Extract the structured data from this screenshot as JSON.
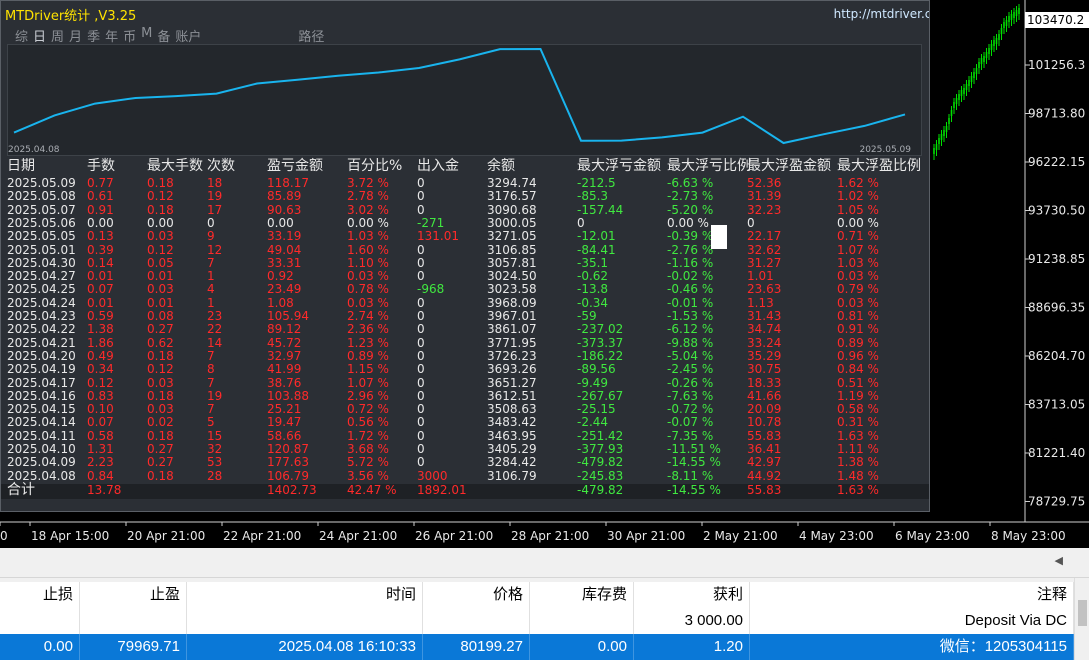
{
  "panel": {
    "title": "MTDriver统计 ,V3.25",
    "url": "http://mtdriver.cn",
    "tabs": [
      "综",
      "日",
      "周",
      "月",
      "季",
      "年",
      "币",
      "M",
      "备",
      "账户",
      "路径"
    ],
    "active_tab": 1,
    "equity": {
      "start_date": "2025.04.08",
      "end_date": "2025.05.09"
    }
  },
  "stats": {
    "headers": [
      "日期",
      "手数",
      "最大手数",
      "次数",
      "盈亏金额",
      "百分比%",
      "出入金",
      "余额",
      "最大浮亏金额",
      "最大浮亏比例",
      "最大浮盈金额",
      "最大浮盈比例"
    ],
    "rows": [
      [
        "2025.05.09",
        "0.77",
        "0.18",
        "18",
        "118.17",
        "3.72 %",
        "0",
        "3294.74",
        "-212.5",
        "-6.63 %",
        "52.36",
        "1.62 %"
      ],
      [
        "2025.05.08",
        "0.61",
        "0.12",
        "19",
        "85.89",
        "2.78 %",
        "0",
        "3176.57",
        "-85.3",
        "-2.73 %",
        "31.39",
        "1.02 %"
      ],
      [
        "2025.05.07",
        "0.91",
        "0.18",
        "17",
        "90.63",
        "3.02 %",
        "0",
        "3090.68",
        "-157.44",
        "-5.20 %",
        "32.23",
        "1.05 %"
      ],
      [
        "2025.05.06",
        "0.00",
        "0.00",
        "0",
        "0.00",
        "0.00 %",
        "-271",
        "3000.05",
        "0",
        "0.00 %",
        "0",
        "0.00 %"
      ],
      [
        "2025.05.05",
        "0.13",
        "0.03",
        "9",
        "33.19",
        "1.03 %",
        "131.01",
        "3271.05",
        "-12.01",
        "-0.39 %",
        "22.17",
        "0.71 %"
      ],
      [
        "2025.05.01",
        "0.39",
        "0.12",
        "12",
        "49.04",
        "1.60 %",
        "0",
        "3106.85",
        "-84.41",
        "-2.76 %",
        "32.62",
        "1.07 %"
      ],
      [
        "2025.04.30",
        "0.14",
        "0.05",
        "7",
        "33.31",
        "1.10 %",
        "0",
        "3057.81",
        "-35.1",
        "-1.16 %",
        "31.27",
        "1.03 %"
      ],
      [
        "2025.04.27",
        "0.01",
        "0.01",
        "1",
        "0.92",
        "0.03 %",
        "0",
        "3024.50",
        "-0.62",
        "-0.02 %",
        "1.01",
        "0.03 %"
      ],
      [
        "2025.04.25",
        "0.07",
        "0.03",
        "4",
        "23.49",
        "0.78 %",
        "-968",
        "3023.58",
        "-13.8",
        "-0.46 %",
        "23.63",
        "0.79 %"
      ],
      [
        "2025.04.24",
        "0.01",
        "0.01",
        "1",
        "1.08",
        "0.03 %",
        "0",
        "3968.09",
        "-0.34",
        "-0.01 %",
        "1.13",
        "0.03 %"
      ],
      [
        "2025.04.23",
        "0.59",
        "0.08",
        "23",
        "105.94",
        "2.74 %",
        "0",
        "3967.01",
        "-59",
        "-1.53 %",
        "31.43",
        "0.81 %"
      ],
      [
        "2025.04.22",
        "1.38",
        "0.27",
        "22",
        "89.12",
        "2.36 %",
        "0",
        "3861.07",
        "-237.02",
        "-6.12 %",
        "34.74",
        "0.91 %"
      ],
      [
        "2025.04.21",
        "1.86",
        "0.62",
        "14",
        "45.72",
        "1.23 %",
        "0",
        "3771.95",
        "-373.37",
        "-9.88 %",
        "33.24",
        "0.89 %"
      ],
      [
        "2025.04.20",
        "0.49",
        "0.18",
        "7",
        "32.97",
        "0.89 %",
        "0",
        "3726.23",
        "-186.22",
        "-5.04 %",
        "35.29",
        "0.96 %"
      ],
      [
        "2025.04.19",
        "0.34",
        "0.12",
        "8",
        "41.99",
        "1.15 %",
        "0",
        "3693.26",
        "-89.56",
        "-2.45 %",
        "30.75",
        "0.84 %"
      ],
      [
        "2025.04.17",
        "0.12",
        "0.03",
        "7",
        "38.76",
        "1.07 %",
        "0",
        "3651.27",
        "-9.49",
        "-0.26 %",
        "18.33",
        "0.51 %"
      ],
      [
        "2025.04.16",
        "0.83",
        "0.18",
        "19",
        "103.88",
        "2.96 %",
        "0",
        "3612.51",
        "-267.67",
        "-7.63 %",
        "41.66",
        "1.19 %"
      ],
      [
        "2025.04.15",
        "0.10",
        "0.03",
        "7",
        "25.21",
        "0.72 %",
        "0",
        "3508.63",
        "-25.15",
        "-0.72 %",
        "20.09",
        "0.58 %"
      ],
      [
        "2025.04.14",
        "0.07",
        "0.02",
        "5",
        "19.47",
        "0.56 %",
        "0",
        "3483.42",
        "-2.44",
        "-0.07 %",
        "10.78",
        "0.31 %"
      ],
      [
        "2025.04.11",
        "0.58",
        "0.18",
        "15",
        "58.66",
        "1.72 %",
        "0",
        "3463.95",
        "-251.42",
        "-7.35 %",
        "55.83",
        "1.63 %"
      ],
      [
        "2025.04.10",
        "1.31",
        "0.27",
        "32",
        "120.87",
        "3.68 %",
        "0",
        "3405.29",
        "-377.93",
        "-11.51 %",
        "36.41",
        "1.11 %"
      ],
      [
        "2025.04.09",
        "2.23",
        "0.27",
        "53",
        "177.63",
        "5.72 %",
        "0",
        "3284.42",
        "-479.82",
        "-14.55 %",
        "42.97",
        "1.38 %"
      ],
      [
        "2025.04.08",
        "0.84",
        "0.18",
        "28",
        "106.79",
        "3.56 %",
        "3000",
        "3106.79",
        "-245.83",
        "-8.11 %",
        "44.92",
        "1.48 %"
      ]
    ],
    "total": [
      "合计",
      "13.78",
      "",
      "",
      "1402.73",
      "42.47 %",
      "1892.01",
      "",
      "-479.82",
      "-14.55 %",
      "55.83",
      "1.63 %"
    ]
  },
  "chart": {
    "current_price": "103470.2",
    "price_labels": [
      "101256.3",
      "98713.80",
      "96222.15",
      "93730.50",
      "91238.85",
      "88696.35",
      "86204.70",
      "83713.05",
      "81221.40",
      "78729.75"
    ],
    "time_labels": [
      "0",
      "18 Apr 15:00",
      "20 Apr 21:00",
      "22 Apr 21:00",
      "24 Apr 21:00",
      "26 Apr 21:00",
      "28 Apr 21:00",
      "30 Apr 21:00",
      "2 May 21:00",
      "4 May 23:00",
      "6 May 23:00",
      "8 May 23:00"
    ],
    "candle_color": "#00e000"
  },
  "trades": {
    "headers": [
      "止损",
      "止盈",
      "时间",
      "价格",
      "库存费",
      "获利",
      "注释"
    ],
    "rows": [
      [
        "",
        "",
        "",
        "",
        "",
        "3 000.00",
        "Deposit Via DC"
      ],
      [
        "0.00",
        "79969.71",
        "2025.04.08 16:10:33",
        "80199.27",
        "0.00",
        "1.20",
        "微信：1205304115"
      ]
    ]
  }
}
